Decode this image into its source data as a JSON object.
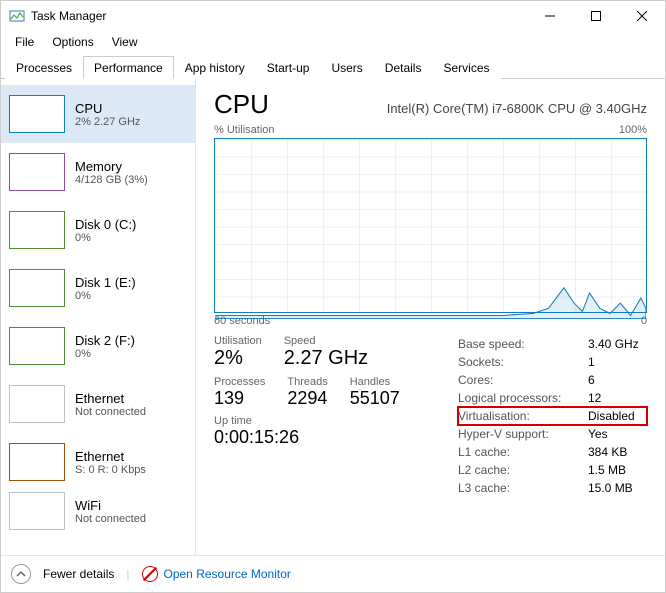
{
  "window": {
    "title": "Task Manager"
  },
  "menu": {
    "file": "File",
    "options": "Options",
    "view": "View"
  },
  "tabs": {
    "processes": "Processes",
    "performance": "Performance",
    "app_history": "App history",
    "startup": "Start-up",
    "users": "Users",
    "details": "Details",
    "services": "Services"
  },
  "sidebar": {
    "items": [
      {
        "title": "CPU",
        "sub": "2% 2.27 GHz"
      },
      {
        "title": "Memory",
        "sub": "4/128 GB (3%)"
      },
      {
        "title": "Disk 0 (C:)",
        "sub": "0%"
      },
      {
        "title": "Disk 1 (E:)",
        "sub": "0%"
      },
      {
        "title": "Disk 2 (F:)",
        "sub": "0%"
      },
      {
        "title": "Ethernet",
        "sub": "Not connected"
      },
      {
        "title": "Ethernet",
        "sub": "S: 0 R: 0 Kbps"
      },
      {
        "title": "WiFi",
        "sub": "Not connected"
      }
    ]
  },
  "main": {
    "title": "CPU",
    "subtitle": "Intel(R) Core(TM) i7-6800K CPU @ 3.40GHz",
    "chart_top_left": "% Utilisation",
    "chart_top_right": "100%",
    "chart_bottom_left": "60 seconds",
    "chart_bottom_right": "0",
    "stats": {
      "utilisation_label": "Utilisation",
      "utilisation_value": "2%",
      "speed_label": "Speed",
      "speed_value": "2.27 GHz",
      "processes_label": "Processes",
      "processes_value": "139",
      "threads_label": "Threads",
      "threads_value": "2294",
      "handles_label": "Handles",
      "handles_value": "55107",
      "uptime_label": "Up time",
      "uptime_value": "0:00:15:26"
    },
    "right": [
      {
        "k": "Base speed:",
        "v": "3.40 GHz"
      },
      {
        "k": "Sockets:",
        "v": "1"
      },
      {
        "k": "Cores:",
        "v": "6"
      },
      {
        "k": "Logical processors:",
        "v": "12"
      },
      {
        "k": "Virtualisation:",
        "v": "Disabled"
      },
      {
        "k": "Hyper-V support:",
        "v": "Yes"
      },
      {
        "k": "L1 cache:",
        "v": "384 KB"
      },
      {
        "k": "L2 cache:",
        "v": "1.5 MB"
      },
      {
        "k": "L3 cache:",
        "v": "15.0 MB"
      }
    ]
  },
  "footer": {
    "fewer": "Fewer details",
    "orm": "Open Resource Monitor"
  },
  "chart_data": {
    "type": "line",
    "title": "% Utilisation",
    "xlabel": "seconds ago",
    "ylabel": "Utilisation %",
    "ylim": [
      0,
      100
    ],
    "xlim": [
      60,
      0
    ],
    "x": [
      60,
      55,
      50,
      45,
      40,
      35,
      30,
      25,
      20,
      15,
      12,
      10,
      9,
      8,
      7,
      6,
      5,
      4,
      3,
      2,
      1,
      0
    ],
    "values": [
      2,
      2,
      2,
      2,
      2,
      2,
      2,
      2,
      2,
      2,
      3,
      6,
      18,
      8,
      4,
      10,
      5,
      3,
      6,
      2,
      8,
      4
    ]
  }
}
